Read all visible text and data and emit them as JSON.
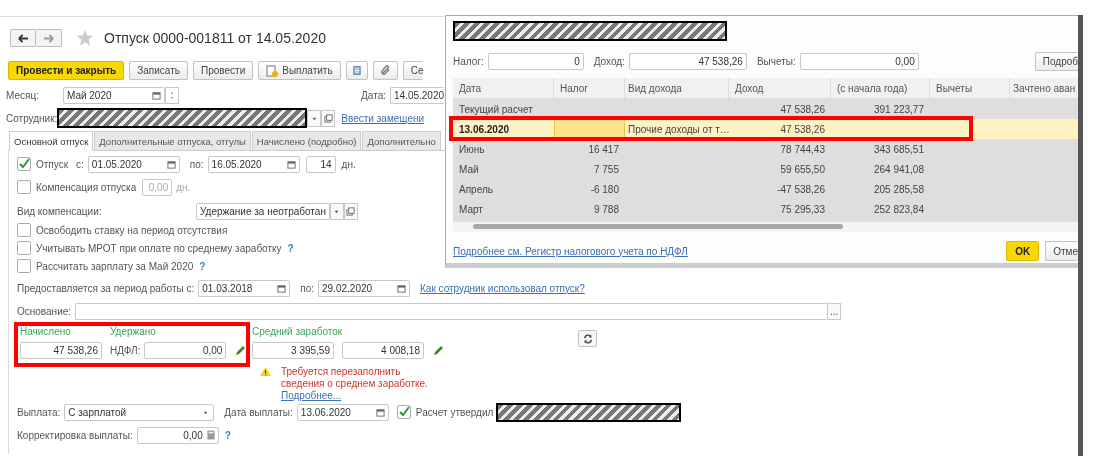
{
  "form": {
    "title": "Отпуск 0000-001811 от 14.05.2020",
    "toolbar": [
      {
        "label": "Провести и закрыть",
        "kind": "primary"
      },
      {
        "label": "Записать",
        "kind": "plain"
      },
      {
        "label": "Провести",
        "kind": "plain"
      },
      {
        "label": "Выплатить",
        "kind": "icon-text"
      },
      {
        "label": "Се",
        "kind": "plain"
      }
    ],
    "month": {
      "label": "Месяц:",
      "value": "Май 2020"
    },
    "date": {
      "label": "Дата:",
      "value": "14.05.2020"
    },
    "employee": {
      "label": "Сотрудник:",
      "link": "Ввести замещени"
    },
    "tabs": [
      {
        "label": "Основной отпуск",
        "selected": true
      },
      {
        "label": "Дополнительные отпуска, отгулы",
        "selected": false
      },
      {
        "label": "Начислено (подробно)",
        "selected": false
      },
      {
        "label": "Дополнительно",
        "selected": false
      }
    ],
    "vacation": {
      "checked": true,
      "label": "Отпуск",
      "from_label": "с:",
      "from": "01.05.2020",
      "to_label": "по:",
      "to": "16.05.2020",
      "days": "14",
      "days_unit": "дн."
    },
    "compensation": {
      "checked": false,
      "label": "Компенсация отпуска",
      "value": "0,00",
      "unit": "дн.",
      "disabled": true
    },
    "compensation_type": {
      "label": "Вид компенсации:",
      "value": "Удержание за неотработан"
    },
    "options": [
      {
        "label": "Освободить ставку на период отсутствия",
        "checked": false
      },
      {
        "label": "Учитывать МРОТ при оплате по среднему заработку",
        "checked": false,
        "help": "?"
      },
      {
        "label": "Рассчитать зарплату за Май 2020",
        "checked": false,
        "help": "?"
      }
    ],
    "period": {
      "label": "Предоставляется за период работы с:",
      "from": "01.03.2018",
      "to_label": "по:",
      "to": "29.02.2020",
      "link": "Как сотрудник использовал отпуск?"
    },
    "basis": {
      "label": "Основание:",
      "button": "..."
    },
    "totals": {
      "accrued_label": "Начислено",
      "accrued": "47 538,26",
      "withheld_label": "Удержано",
      "ndfl_label": "НДФЛ:",
      "ndfl": "0,00",
      "avg_label": "Средний заработок",
      "avg_1": "3 395,59",
      "avg_2": "4 008,18"
    },
    "warning": {
      "text": "Требуется перезаполнить сведения о среднем заработке.",
      "link": "Подробнее..."
    },
    "payment": {
      "label": "Выплата:",
      "value": "С зарплатой",
      "date_label": "Дата выплаты:",
      "date": "13.06.2020",
      "approved_checked": true,
      "approved_label": "Расчет утвердил"
    },
    "correction": {
      "label": "Корректировка выплаты:",
      "value": "0,00",
      "help": "?"
    }
  },
  "dialog": {
    "tax_label": "Налог:",
    "tax": "0",
    "income_label": "Доход:",
    "income": "47 538,26",
    "deductions_label": "Вычеты:",
    "deductions": "0,00",
    "details_button": "Подроб",
    "columns": [
      "Дата",
      "Налог",
      "Вид дохода",
      "Доход",
      "(с начала года)",
      "Вычеты",
      "Зачтено аван"
    ],
    "rows": [
      {
        "date": "Текущий расчет",
        "income": "47 538,26",
        "ytd": "391 223,77",
        "selected": false
      },
      {
        "date": "13.06.2020",
        "income_type": "Прочие доходы от т…",
        "income": "47 538,26",
        "selected": true
      },
      {
        "date": "Июнь",
        "tax": "16 417",
        "income": "78 744,43",
        "ytd": "343 685,51",
        "selected": false
      },
      {
        "date": "Май",
        "tax": "7 755",
        "income": "59 655,50",
        "ytd": "264 941,08",
        "selected": false
      },
      {
        "date": "Апрель",
        "tax": "-6 180",
        "income": "-47 538,26",
        "ytd": "205 285,58",
        "selected": false
      },
      {
        "date": "Март",
        "tax": "9 788",
        "income": "75 295,33",
        "ytd": "252 823,84",
        "selected": false
      }
    ],
    "link": "Подробнее см. Регистр налогового учета по НДФЛ",
    "ok": "OK",
    "cancel": "Отме"
  }
}
